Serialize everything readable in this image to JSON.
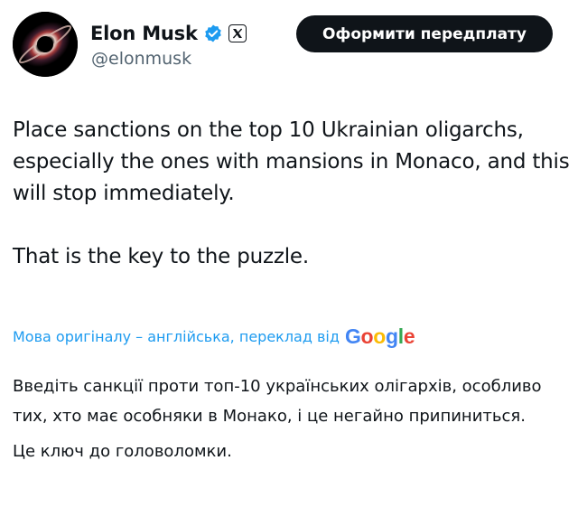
{
  "author": {
    "display_name": "Elon Musk",
    "handle": "@elonmusk",
    "avatar_icon": "black-hole-avatar",
    "verified_icon": "verified-badge-icon",
    "affiliate_icon": "x-logo-icon"
  },
  "header": {
    "subscribe_label": "Оформити передплату"
  },
  "tweet": {
    "paragraphs": [
      "Place sanctions on the top 10 Ukrainian oligarchs, especially the ones with mansions in Monaco, and this will stop immediately.",
      "That is the key to the puzzle."
    ]
  },
  "translation": {
    "notice": "Мова оригіналу – англійська, переклад від",
    "provider": "Google",
    "paragraphs": [
      "Введіть санкції проти топ-10 українських олігархів, особливо тих, хто має особняки в Монако, і це негайно припиниться.",
      "Це ключ до головоломки."
    ]
  },
  "colors": {
    "text": "#0f1419",
    "muted": "#536471",
    "link": "#1d9bf0",
    "verified": "#1d9bf0",
    "button_bg": "#0f1419",
    "button_text": "#ffffff"
  }
}
